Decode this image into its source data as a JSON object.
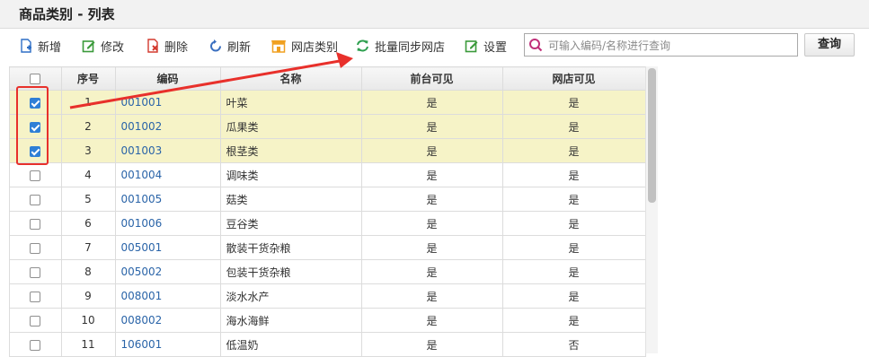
{
  "page": {
    "title": "商品类别 - 列表"
  },
  "toolbar": {
    "buttons": [
      {
        "id": "add",
        "label": "新增",
        "icon": "add-doc-icon",
        "color": "#2f6fc6"
      },
      {
        "id": "edit",
        "label": "修改",
        "icon": "edit-icon",
        "color": "#3a9a3a"
      },
      {
        "id": "delete",
        "label": "删除",
        "icon": "delete-doc-icon",
        "color": "#d33a2f"
      },
      {
        "id": "refresh",
        "label": "刷新",
        "icon": "refresh-icon",
        "color": "#3a6fc0"
      },
      {
        "id": "shop-category",
        "label": "网店类别",
        "icon": "shop-icon",
        "color": "#f0a020"
      },
      {
        "id": "batch-sync",
        "label": "批量同步网店",
        "icon": "sync-icon",
        "color": "#2fa050"
      },
      {
        "id": "settings",
        "label": "设置",
        "icon": "settings-edit-icon",
        "color": "#3a9a3a"
      }
    ],
    "search": {
      "placeholder": "可输入编码/名称进行查询",
      "value": ""
    },
    "query_label": "查询"
  },
  "table": {
    "columns": [
      "",
      "序号",
      "编码",
      "名称",
      "前台可见",
      "网店可见"
    ],
    "rows": [
      {
        "checked": true,
        "no": "1",
        "code": "001001",
        "name": "叶菜",
        "front": "是",
        "shop": "是"
      },
      {
        "checked": true,
        "no": "2",
        "code": "001002",
        "name": "瓜果类",
        "front": "是",
        "shop": "是"
      },
      {
        "checked": true,
        "no": "3",
        "code": "001003",
        "name": "根茎类",
        "front": "是",
        "shop": "是"
      },
      {
        "checked": false,
        "no": "4",
        "code": "001004",
        "name": "调味类",
        "front": "是",
        "shop": "是"
      },
      {
        "checked": false,
        "no": "5",
        "code": "001005",
        "name": "菇类",
        "front": "是",
        "shop": "是"
      },
      {
        "checked": false,
        "no": "6",
        "code": "001006",
        "name": "豆谷类",
        "front": "是",
        "shop": "是"
      },
      {
        "checked": false,
        "no": "7",
        "code": "005001",
        "name": "散装干货杂粮",
        "front": "是",
        "shop": "是"
      },
      {
        "checked": false,
        "no": "8",
        "code": "005002",
        "name": "包装干货杂粮",
        "front": "是",
        "shop": "是"
      },
      {
        "checked": false,
        "no": "9",
        "code": "008001",
        "name": "淡水水产",
        "front": "是",
        "shop": "是"
      },
      {
        "checked": false,
        "no": "10",
        "code": "008002",
        "name": "海水海鲜",
        "front": "是",
        "shop": "是"
      },
      {
        "checked": false,
        "no": "11",
        "code": "106001",
        "name": "低温奶",
        "front": "是",
        "shop": "否"
      }
    ]
  },
  "colors": {
    "selected_row": "#f6f3c7",
    "code_link": "#2a64a8",
    "annotation": "#e8302b"
  }
}
